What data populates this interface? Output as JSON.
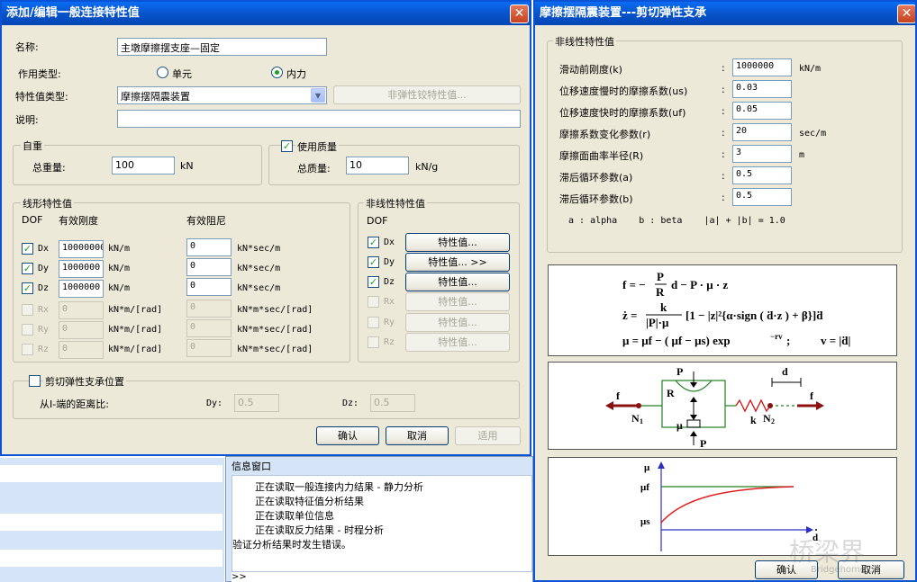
{
  "dlg1": {
    "title": "添加/编辑一般连接特性值",
    "close": "✕",
    "name_label": "名称:",
    "name_value": "主墩摩擦摆支座—固定",
    "action_label": "作用类型:",
    "action_single": "单元",
    "action_force": "内力",
    "prop_type_label": "特性值类型:",
    "prop_type_value": "摩擦摆隔震装置",
    "nonlinear_hinge_btn": "非弹性铰特性值...",
    "desc_label": "说明:",
    "desc_value": "",
    "selfweight": {
      "legend": "自重",
      "label": "总重量:",
      "value": "100",
      "unit": "kN"
    },
    "mass": {
      "legend": "使用质量",
      "label": "总质量:",
      "value": "10",
      "unit": "kN/g"
    },
    "linear": {
      "legend": "线形特性值",
      "dof": "DOF",
      "stiff": "有效刚度",
      "damp": "有效阻尼",
      "rows": [
        {
          "dof": "Dx",
          "k": "10000000",
          "ku": "kN/m",
          "c": "0",
          "cu": "kN*sec/m"
        },
        {
          "dof": "Dy",
          "k": "1000000",
          "ku": "kN/m",
          "c": "0",
          "cu": "kN*sec/m"
        },
        {
          "dof": "Dz",
          "k": "1000000",
          "ku": "kN/m",
          "c": "0",
          "cu": "kN*sec/m"
        },
        {
          "dof": "Rx",
          "k": "0",
          "ku": "kN*m/[rad]",
          "c": "0",
          "cu": "kN*m*sec/[rad]"
        },
        {
          "dof": "Ry",
          "k": "0",
          "ku": "kN*m/[rad]",
          "c": "0",
          "cu": "kN*m*sec/[rad]"
        },
        {
          "dof": "Rz",
          "k": "0",
          "ku": "kN*m/[rad]",
          "c": "0",
          "cu": "kN*m*sec/[rad]"
        }
      ]
    },
    "nonlin": {
      "legend": "非线性特性值",
      "dof": "DOF",
      "rows": [
        {
          "dof": "Dx",
          "btn": "特性值..."
        },
        {
          "dof": "Dy",
          "btn": "特性值... >>"
        },
        {
          "dof": "Dz",
          "btn": "特性值..."
        },
        {
          "dof": "Rx",
          "btn": "特性值..."
        },
        {
          "dof": "Ry",
          "btn": "特性值..."
        },
        {
          "dof": "Rz",
          "btn": "特性值..."
        }
      ]
    },
    "shear": {
      "legend": "剪切弹性支承位置",
      "ratio": "从I-端的距离比:",
      "dy": "Dy:",
      "dy_val": "0.5",
      "dz": "Dz:",
      "dz_val": "0.5"
    },
    "ok": "确认",
    "cancel": "取消",
    "apply": "适用"
  },
  "info": {
    "title": "信息窗口",
    "lines": [
      "正在读取一般连接内力结果 - 静力分析",
      "正在读取特征值分析结果",
      "正在读取单位信息",
      "正在读取反力结果 - 时程分析",
      "验证分析结果时发生错误。"
    ],
    "prompt": ">>"
  },
  "dlg2": {
    "title": "摩擦摆隔震装置---剪切弹性支承",
    "close": "✕",
    "legend": "非线性特性值",
    "params": [
      {
        "label": "滑动前刚度(k)",
        "value": "1000000",
        "unit": "kN/m"
      },
      {
        "label": "位移速度慢时的摩擦系数(us)",
        "value": "0.03",
        "unit": ""
      },
      {
        "label": "位移速度快时的摩擦系数(uf)",
        "value": "0.05",
        "unit": ""
      },
      {
        "label": "摩擦系数变化参数(r)",
        "value": "20",
        "unit": "sec/m"
      },
      {
        "label": "摩擦面曲率半径(R)",
        "value": "3",
        "unit": "m"
      },
      {
        "label": "滞后循环参数(a)",
        "value": "0.5",
        "unit": ""
      },
      {
        "label": "滞后循环参数(b)",
        "value": "0.5",
        "unit": ""
      }
    ],
    "colon": ":",
    "note": "a : alpha    b : beta    |a| + |b| = 1.0",
    "diag": {
      "P": "P",
      "R": "R",
      "d": "d",
      "f": "f",
      "N1": "N",
      "N2": "N",
      "mu": "μ",
      "k": "k",
      "mu_ax": "μ",
      "muf": "μf",
      "mus": "μs"
    },
    "ok": "确认",
    "cancel": "取消",
    "watermark": "桥梁界",
    "watermark_url": "Bridgehome.cn"
  },
  "colors": {
    "title": "#0752c8",
    "check": "#21a121",
    "spring": "#d01010",
    "arrow": "#8b1010",
    "curve": "#e02020",
    "line": "#208020"
  }
}
